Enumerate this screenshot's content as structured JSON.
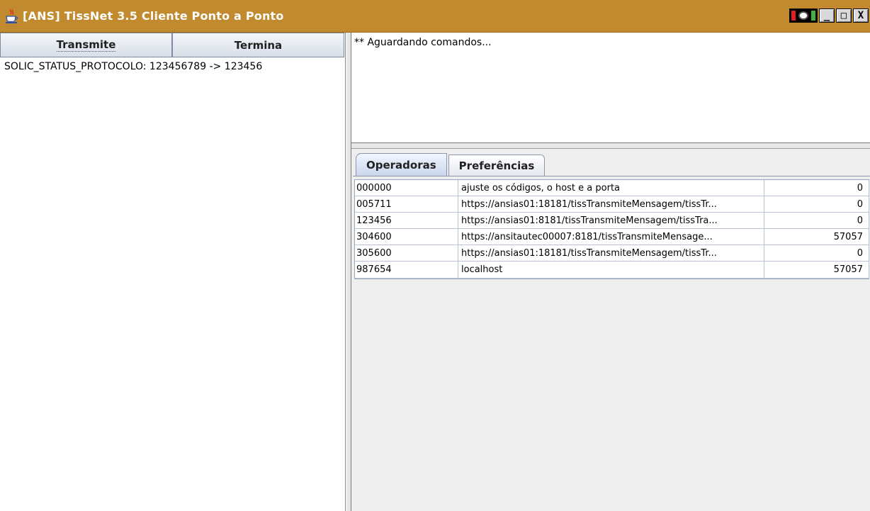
{
  "window": {
    "title": "[ANS] TissNet 3.5 Cliente Ponto a Ponto",
    "title_bar_color": "#c18a2e",
    "buttons": {
      "minimize": "_",
      "maximize": "□",
      "close": "X"
    }
  },
  "left": {
    "buttons": [
      "Transmite",
      "Termina"
    ],
    "items": [
      "SOLIC_STATUS_PROTOCOLO: 123456789 -> 123456"
    ]
  },
  "console": {
    "text": "** Aguardando comandos..."
  },
  "tabs": [
    {
      "label": "Operadoras",
      "selected": true
    },
    {
      "label": "Preferências",
      "selected": false
    }
  ],
  "table": {
    "rows": [
      {
        "code": "000000",
        "url": "ajuste os códigos, o host e a porta",
        "port": "0"
      },
      {
        "code": "005711",
        "url": "https://ansias01:18181/tissTransmiteMensagem/tissTr...",
        "port": "0"
      },
      {
        "code": "123456",
        "url": "https://ansias01:8181/tissTransmiteMensagem/tissTra...",
        "port": "0"
      },
      {
        "code": "304600",
        "url": "https://ansitautec00007:8181/tissTransmiteMensage...",
        "port": "57057"
      },
      {
        "code": "305600",
        "url": "https://ansias01:18181/tissTransmiteMensagem/tissTr...",
        "port": "0"
      },
      {
        "code": "987654",
        "url": "localhost",
        "port": "57057"
      }
    ]
  }
}
